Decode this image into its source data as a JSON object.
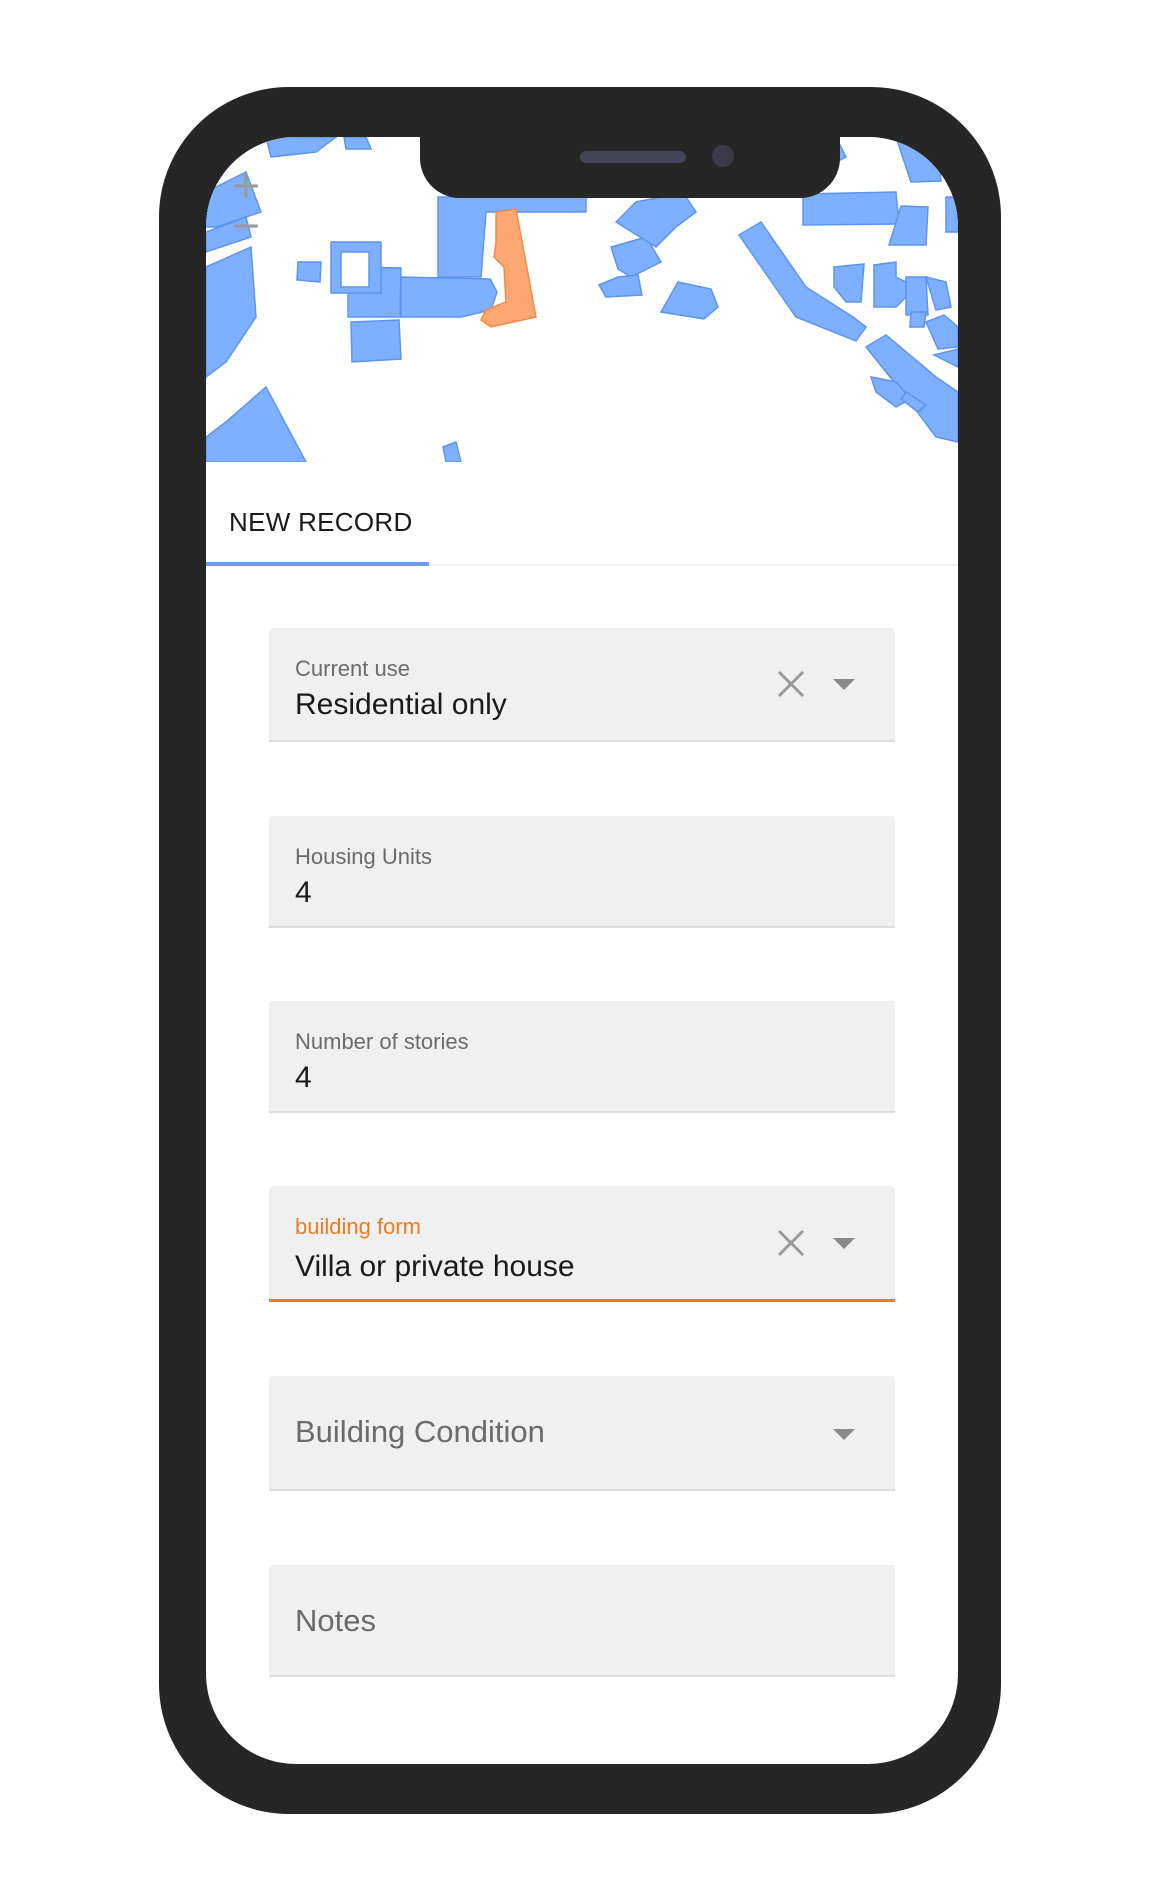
{
  "map": {
    "zoom_in_label": "+",
    "zoom_out_label": "−",
    "building_color": "#7eb0ff",
    "selected_building_color": "#ffa773"
  },
  "tabs": [
    {
      "label": "NEW RECORD",
      "active": true
    }
  ],
  "form": {
    "current_use": {
      "label": "Current use",
      "value": "Residential only"
    },
    "housing_units": {
      "label": "Housing Units",
      "value": "4"
    },
    "number_of_stories": {
      "label": "Number of stories",
      "value": "4"
    },
    "building_form": {
      "label": "building form",
      "value": "Villa or private house"
    },
    "building_condition": {
      "placeholder": "Building Condition"
    },
    "notes": {
      "placeholder": "Notes"
    }
  },
  "colors": {
    "accent_orange": "#f07a22",
    "tab_indicator": "#6f9ae6",
    "field_bg": "#f0f0f0",
    "phone_frame": "#262626"
  }
}
